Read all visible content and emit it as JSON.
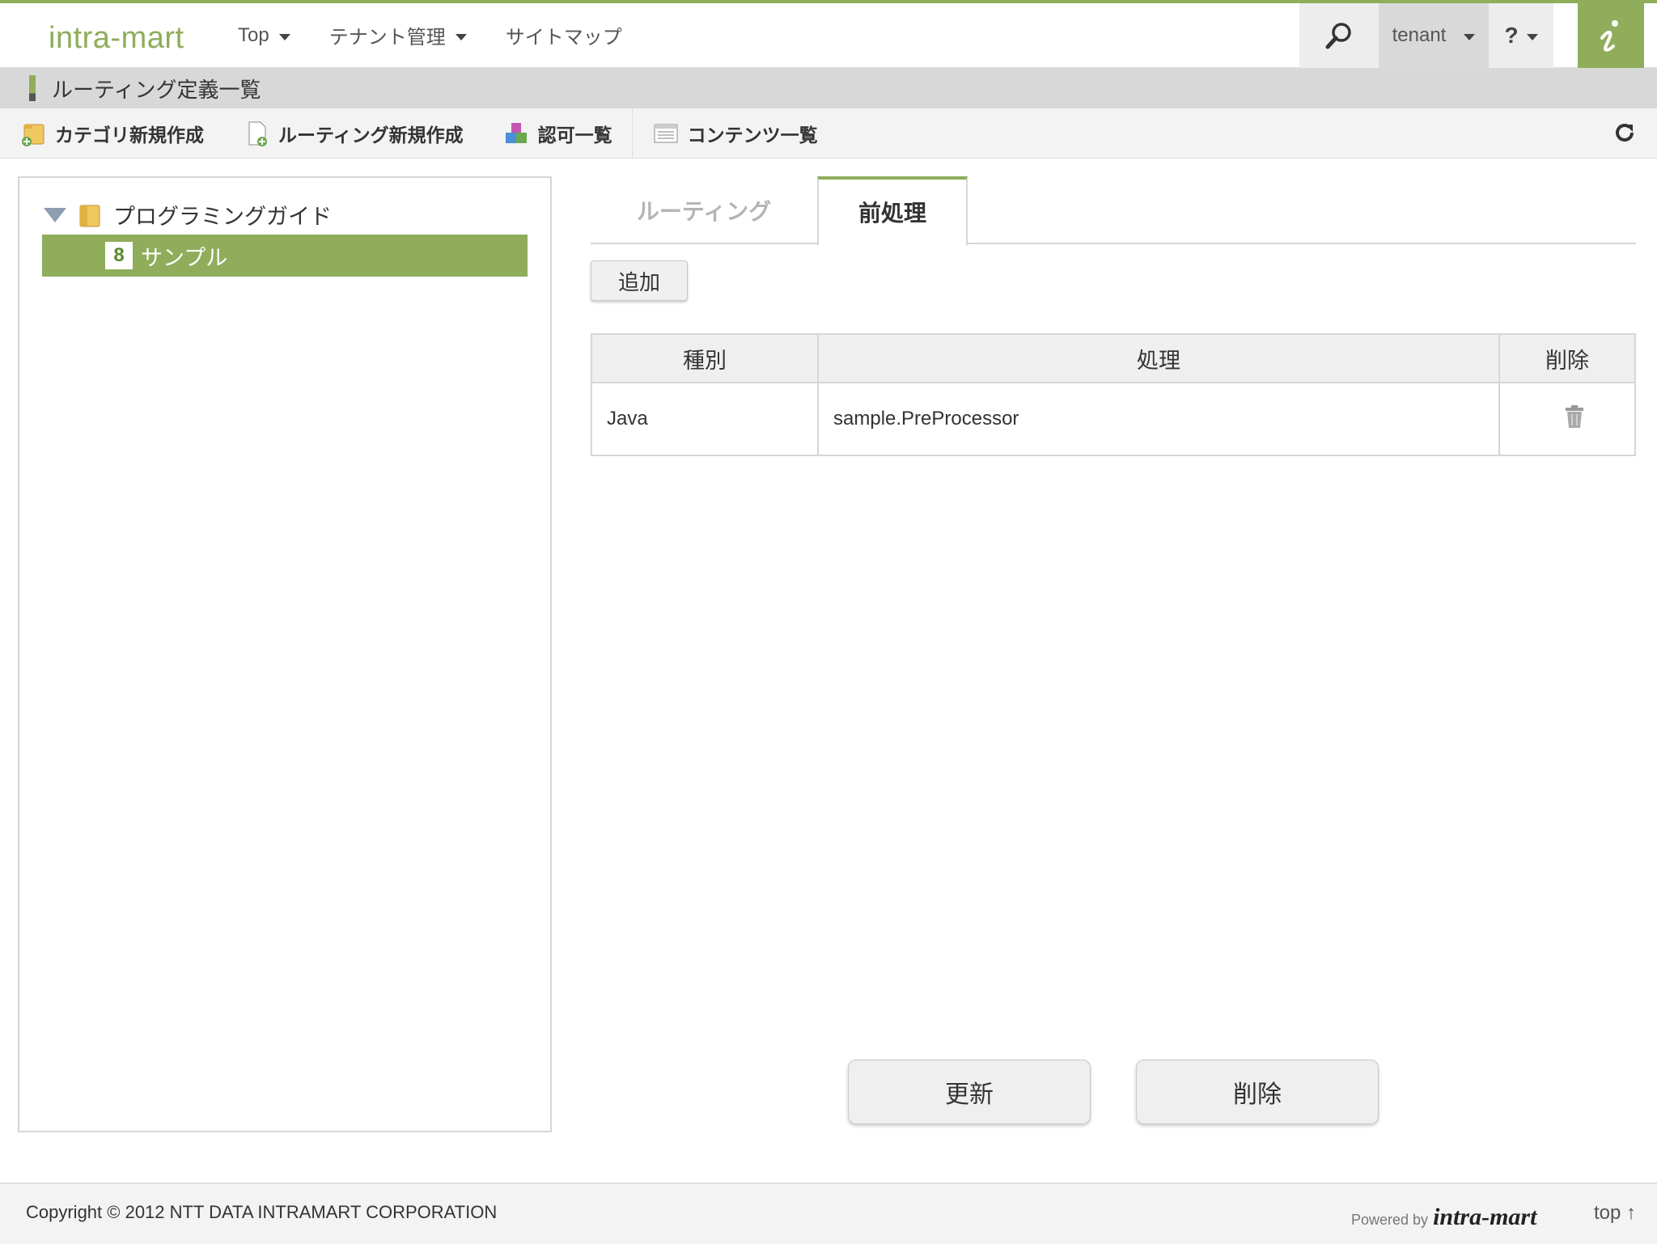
{
  "header": {
    "logo": "intra-mart",
    "nav": [
      {
        "label": "Top"
      },
      {
        "label": "テナント管理"
      },
      {
        "label": "サイトマップ"
      }
    ],
    "user": "tenant",
    "help": "?"
  },
  "page": {
    "title": "ルーティング定義一覧"
  },
  "toolbar": {
    "new_category": "カテゴリ新規作成",
    "new_routing": "ルーティング新規作成",
    "auth_list": "認可一覧",
    "content_list": "コンテンツ一覧"
  },
  "tree": {
    "root": "プログラミングガイド",
    "child": "サンプル",
    "child_badge": "8"
  },
  "tabs": {
    "routing": "ルーティング",
    "preprocess": "前処理"
  },
  "actions": {
    "add": "追加",
    "update": "更新",
    "delete": "削除"
  },
  "table": {
    "headers": {
      "type": "種別",
      "process": "処理",
      "delete": "削除"
    },
    "rows": [
      {
        "type": "Java",
        "process": "sample.PreProcessor"
      }
    ]
  },
  "footer": {
    "copyright": "Copyright © 2012 NTT DATA INTRAMART CORPORATION",
    "powered_by": "Powered by",
    "powered_logo": "intra-mart",
    "top_link": "top ↑"
  },
  "colors": {
    "accent": "#8fad5a",
    "header_bar": "#d8d8d8"
  }
}
